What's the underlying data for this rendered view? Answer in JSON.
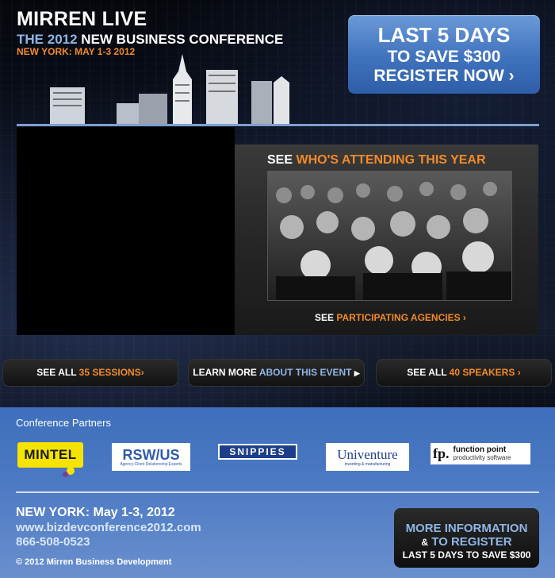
{
  "brand": {
    "title": "MIRREN LIVE",
    "subtitle_the": "THE",
    "subtitle_year": "2012",
    "subtitle_rest": "NEW BUSINESS CONFERENCE",
    "date_line": "NEW YORK: MAY 1-3 2012"
  },
  "register": {
    "line1": "LAST 5 DAYS",
    "line2": "TO SAVE $300",
    "line3": "REGISTER NOW ›"
  },
  "attending": {
    "heading_see": "SEE",
    "heading_rest": "WHO'S ATTENDING THIS YEAR",
    "agencies_see": "SEE",
    "agencies_rest": "PARTICIPATING AGENCIES ›"
  },
  "nav_pills": {
    "sessions_prefix": "SEE ALL",
    "sessions_accent": "35 SESSIONS›",
    "about_prefix": "LEARN MORE",
    "about_accent": "ABOUT THIS EVENT",
    "about_arrow": "▶",
    "speakers_prefix": "SEE ALL",
    "speakers_accent": "40 SPEAKERS ›"
  },
  "partners": {
    "label": "Conference Partners",
    "logos": [
      {
        "name": "MINTEL"
      },
      {
        "name": "RSW/US",
        "tagline": "Agency-Client Relationship Experts"
      },
      {
        "name": "SNIPPIES"
      },
      {
        "name": "Univenture",
        "tagline": "inventing & manufacturing"
      },
      {
        "name": "fp.",
        "line1": "function point",
        "line2": "productivity software"
      }
    ]
  },
  "contact": {
    "city": "NEW YORK: May 1-3, 2012",
    "url": "www.bizdevconference2012.com",
    "phone": "866-508-0523",
    "copyright": "© 2012 Mirren Business Development"
  },
  "more_info": {
    "line1": "MORE INFORMATION",
    "amp": "&",
    "line2": "TO REGISTER",
    "line3": "LAST 5 DAYS TO SAVE $300"
  },
  "colors": {
    "accent_orange": "#f08a2c",
    "accent_blue": "#8fb6e6",
    "register_blue": "#3f72bd",
    "footer_blue": "#4a78c2"
  }
}
